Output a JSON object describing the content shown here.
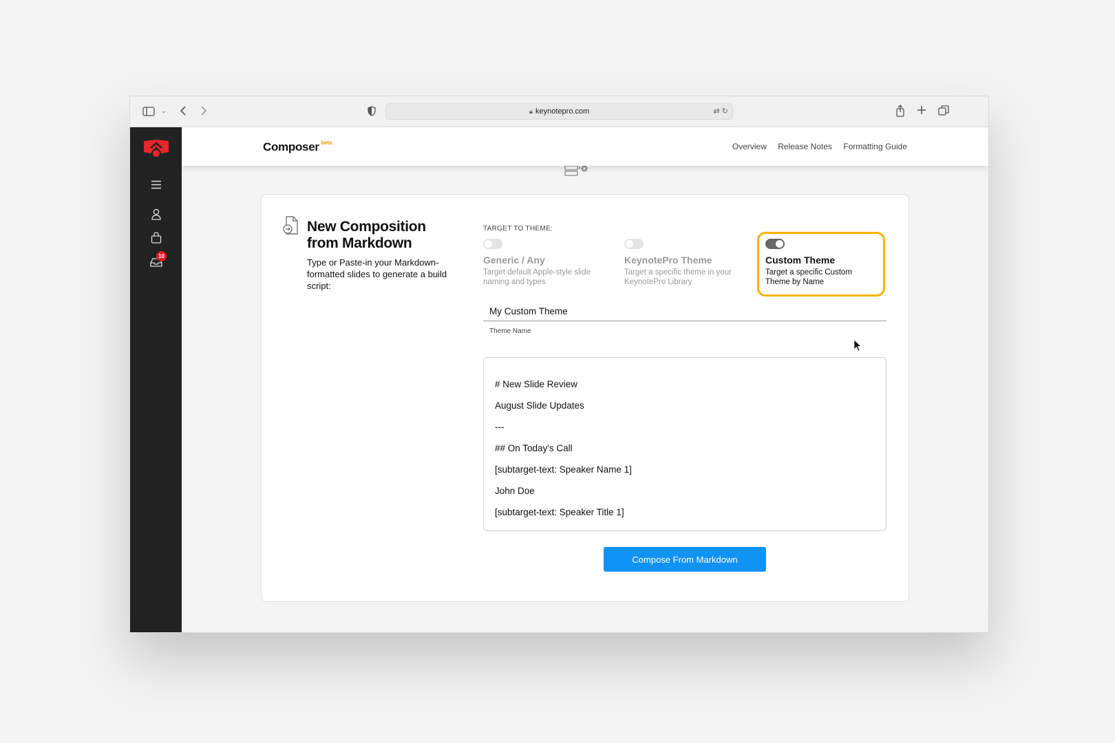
{
  "browser": {
    "url": "keynotepro.com"
  },
  "sidebar": {
    "badge_count": "10"
  },
  "header": {
    "brand": "Composer",
    "brand_tag": "beta",
    "nav": [
      "Overview",
      "Release Notes",
      "Formatting Guide"
    ]
  },
  "composition": {
    "title": "New Composition from Markdown",
    "description": "Type or Paste-in your Markdown-formatted slides to generate a build script:",
    "target_label": "TARGET TO THEME:",
    "options": [
      {
        "title": "Generic / Any",
        "desc": "Target default Apple-style slide naming and types",
        "selected": false
      },
      {
        "title": "KeynotePro Theme",
        "desc": "Target a specific theme in your KeynotePro Library",
        "selected": false
      },
      {
        "title": "Custom Theme",
        "desc": "Target a specific Custom Theme by Name",
        "selected": true
      }
    ],
    "theme_name_value": "My Custom Theme",
    "theme_name_label": "Theme Name",
    "markdown_lines": [
      "# New Slide Review",
      "August Slide Updates",
      "---",
      "## On Today's Call",
      "[subtarget-text: Speaker Name 1]",
      "John Doe",
      "[subtarget-text: Speaker Title 1]"
    ],
    "compose_button": "Compose From Markdown"
  },
  "colors": {
    "accent": "#1192f5",
    "selected_border": "#f7b500",
    "sidebar_bg": "#222222",
    "logo_red": "#e8262b"
  }
}
